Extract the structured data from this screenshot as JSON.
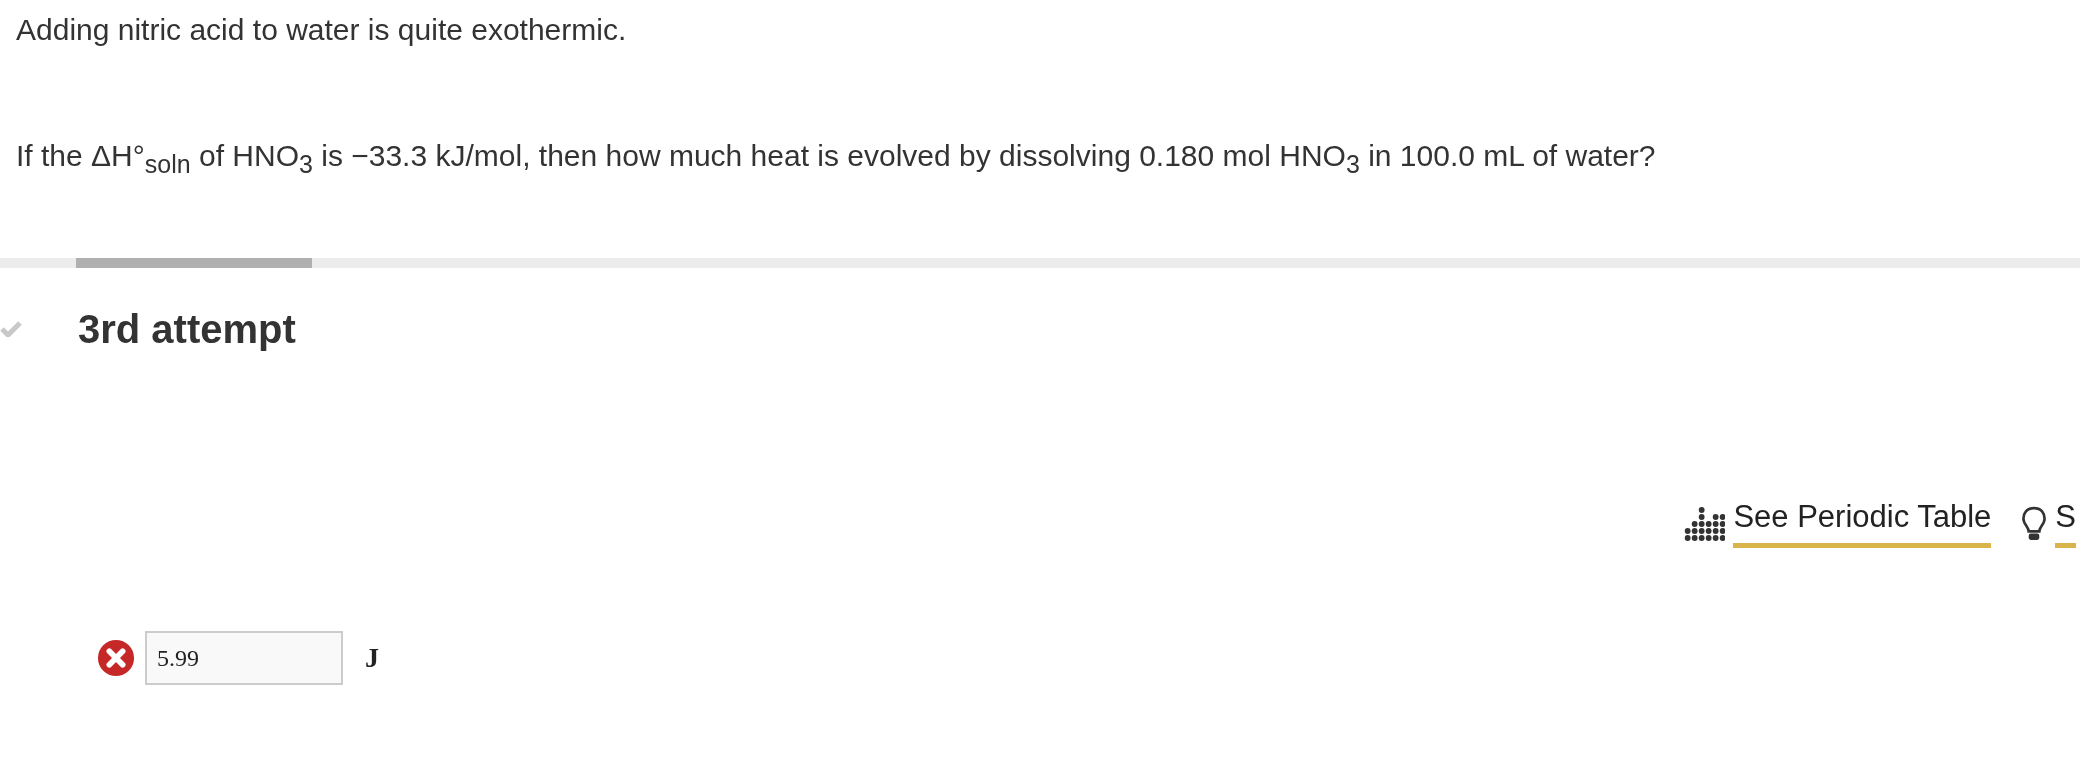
{
  "intro": "Adding nitric acid to water is quite exothermic.",
  "question": "If the ΔH°$_{soln}$ of HNO$_{3}$ is −33.3 kJ/mol, then how much heat is evolved by dissolving 0.180 mol HNO$_{3}$ in 100.0 mL of water?",
  "attempt": {
    "title": "3rd attempt"
  },
  "links": [
    {
      "kind": "table",
      "label": "See Periodic Table"
    },
    {
      "kind": "hint",
      "label": "S"
    }
  ],
  "answer": {
    "correct": false,
    "value": "5.99",
    "unit": "J"
  }
}
